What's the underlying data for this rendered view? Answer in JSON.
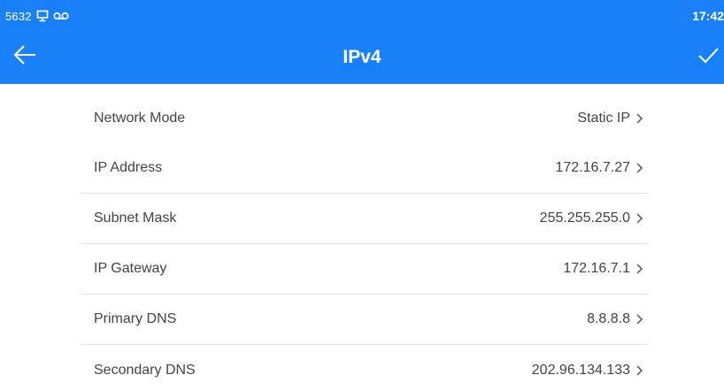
{
  "status_bar": {
    "signal_text": "5632",
    "time": "17:42"
  },
  "header": {
    "title": "IPv4",
    "back_icon": "arrow-left-icon",
    "confirm_icon": "checkmark-icon",
    "background_color": "#1a80f7"
  },
  "rows": [
    {
      "label": "Network Mode",
      "value": "Static IP"
    },
    {
      "label": "IP Address",
      "value": "172.16.7.27"
    },
    {
      "label": "Subnet Mask",
      "value": "255.255.255.0"
    },
    {
      "label": "IP Gateway",
      "value": "172.16.7.1"
    },
    {
      "label": "Primary DNS",
      "value": "8.8.8.8"
    },
    {
      "label": "Secondary DNS",
      "value": "202.96.134.133"
    }
  ]
}
